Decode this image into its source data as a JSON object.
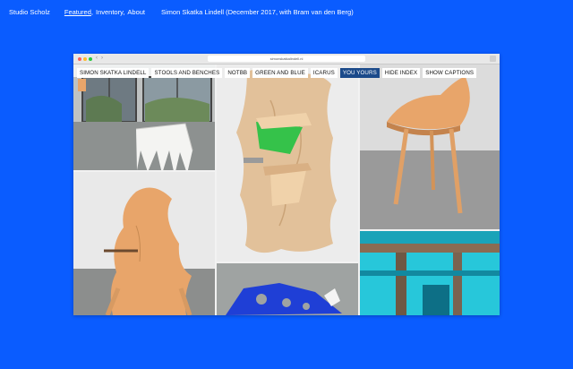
{
  "header": {
    "brand": "Studio Scholz",
    "nav": [
      {
        "label": "Featured",
        "sep": ","
      },
      {
        "label": "Inventory",
        "sep": ","
      },
      {
        "label": "About",
        "sep": ""
      }
    ],
    "project_title": "Simon Skatka Lindell (December 2017, with Bram van den Berg)"
  },
  "browser": {
    "url": "simonskatkalindell.nl",
    "back": "‹",
    "forward": "›"
  },
  "tabs": [
    {
      "label": "SIMON SKATKA LINDELL",
      "active": false
    },
    {
      "label": "STOOLS AND BENCHES",
      "active": false
    },
    {
      "label": "NOTBB",
      "active": false
    },
    {
      "label": "GREEN AND BLUE",
      "active": false
    },
    {
      "label": "ICARUS",
      "active": false
    },
    {
      "label": "YOU YOURS",
      "active": true
    },
    {
      "label": "HIDE INDEX",
      "active": false
    },
    {
      "label": "SHOW CAPTIONS",
      "active": false
    }
  ],
  "colors": {
    "page_background": "#0a5cff",
    "active_tab": "#1b4a8a",
    "wood": "#e8a56a"
  }
}
